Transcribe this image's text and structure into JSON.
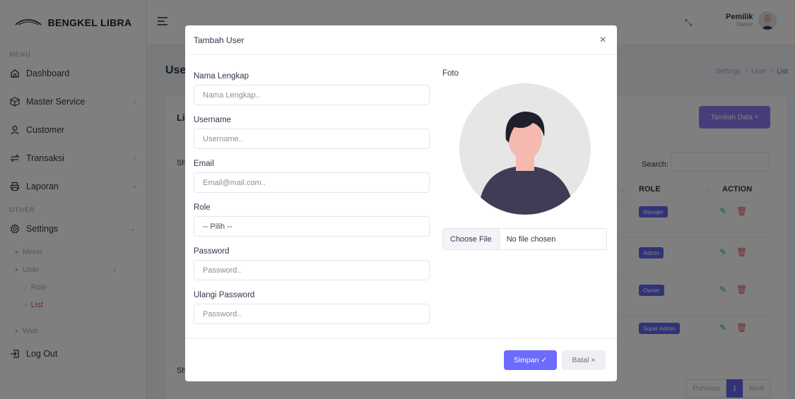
{
  "app": {
    "brand": "BENGKEL LIBRA"
  },
  "sidebar": {
    "menu_label": "MENU",
    "other_label": "OTHER",
    "items": [
      {
        "label": "Dashboard",
        "icon": "home-icon"
      },
      {
        "label": "Master Service",
        "icon": "box-icon"
      },
      {
        "label": "Customer",
        "icon": "user-icon"
      },
      {
        "label": "Transaksi",
        "icon": "transfer-icon"
      },
      {
        "label": "Laporan",
        "icon": "printer-icon"
      }
    ],
    "settings": {
      "label": "Settings",
      "icon": "gear-icon",
      "sub": {
        "menu": "Menu",
        "user": "User",
        "role": "Role",
        "list": "List",
        "web": "Web"
      }
    },
    "logout": {
      "label": "Log Out",
      "icon": "logout-icon"
    }
  },
  "topbar": {
    "user_name": "Pemilik",
    "user_role": "Owner"
  },
  "page": {
    "title": "User",
    "breadcrumb": [
      "Settings",
      "/",
      "User",
      "/",
      "List"
    ],
    "card_title": "List",
    "add_button": "Tambah Data +",
    "show_top": "Sh",
    "show_bottom": "Sh",
    "search_label": "Search:",
    "columns": {
      "role": "ROLE",
      "action": "ACTION"
    },
    "rows": [
      {
        "role": "Manajer"
      },
      {
        "role": "Admin"
      },
      {
        "role": "Owner"
      },
      {
        "role": "Super Admin"
      }
    ],
    "pagination": {
      "prev": "Previous",
      "current": "1",
      "next": "Next"
    }
  },
  "modal": {
    "title": "Tambah User",
    "close": "×",
    "fields": {
      "nama": {
        "label": "Nama Lengkap",
        "placeholder": "Nama Lengkap.."
      },
      "username": {
        "label": "Username",
        "placeholder": "Username.."
      },
      "email": {
        "label": "Email",
        "placeholder": "Email@mail.com.."
      },
      "role": {
        "label": "Role",
        "value": "-- Pilih --"
      },
      "password": {
        "label": "Password",
        "placeholder": "Password.."
      },
      "ulangi": {
        "label": "Ulangi Password",
        "placeholder": "Password.."
      }
    },
    "foto_label": "Foto",
    "file_button": "Choose File",
    "file_text": "No file chosen",
    "save_button": "Simpan ✓",
    "cancel_button": "Batal ×"
  },
  "colors": {
    "primary": "#6d6afe",
    "badge": "#6366f1",
    "danger": "#e0555f",
    "edit": "#2fb67d"
  }
}
